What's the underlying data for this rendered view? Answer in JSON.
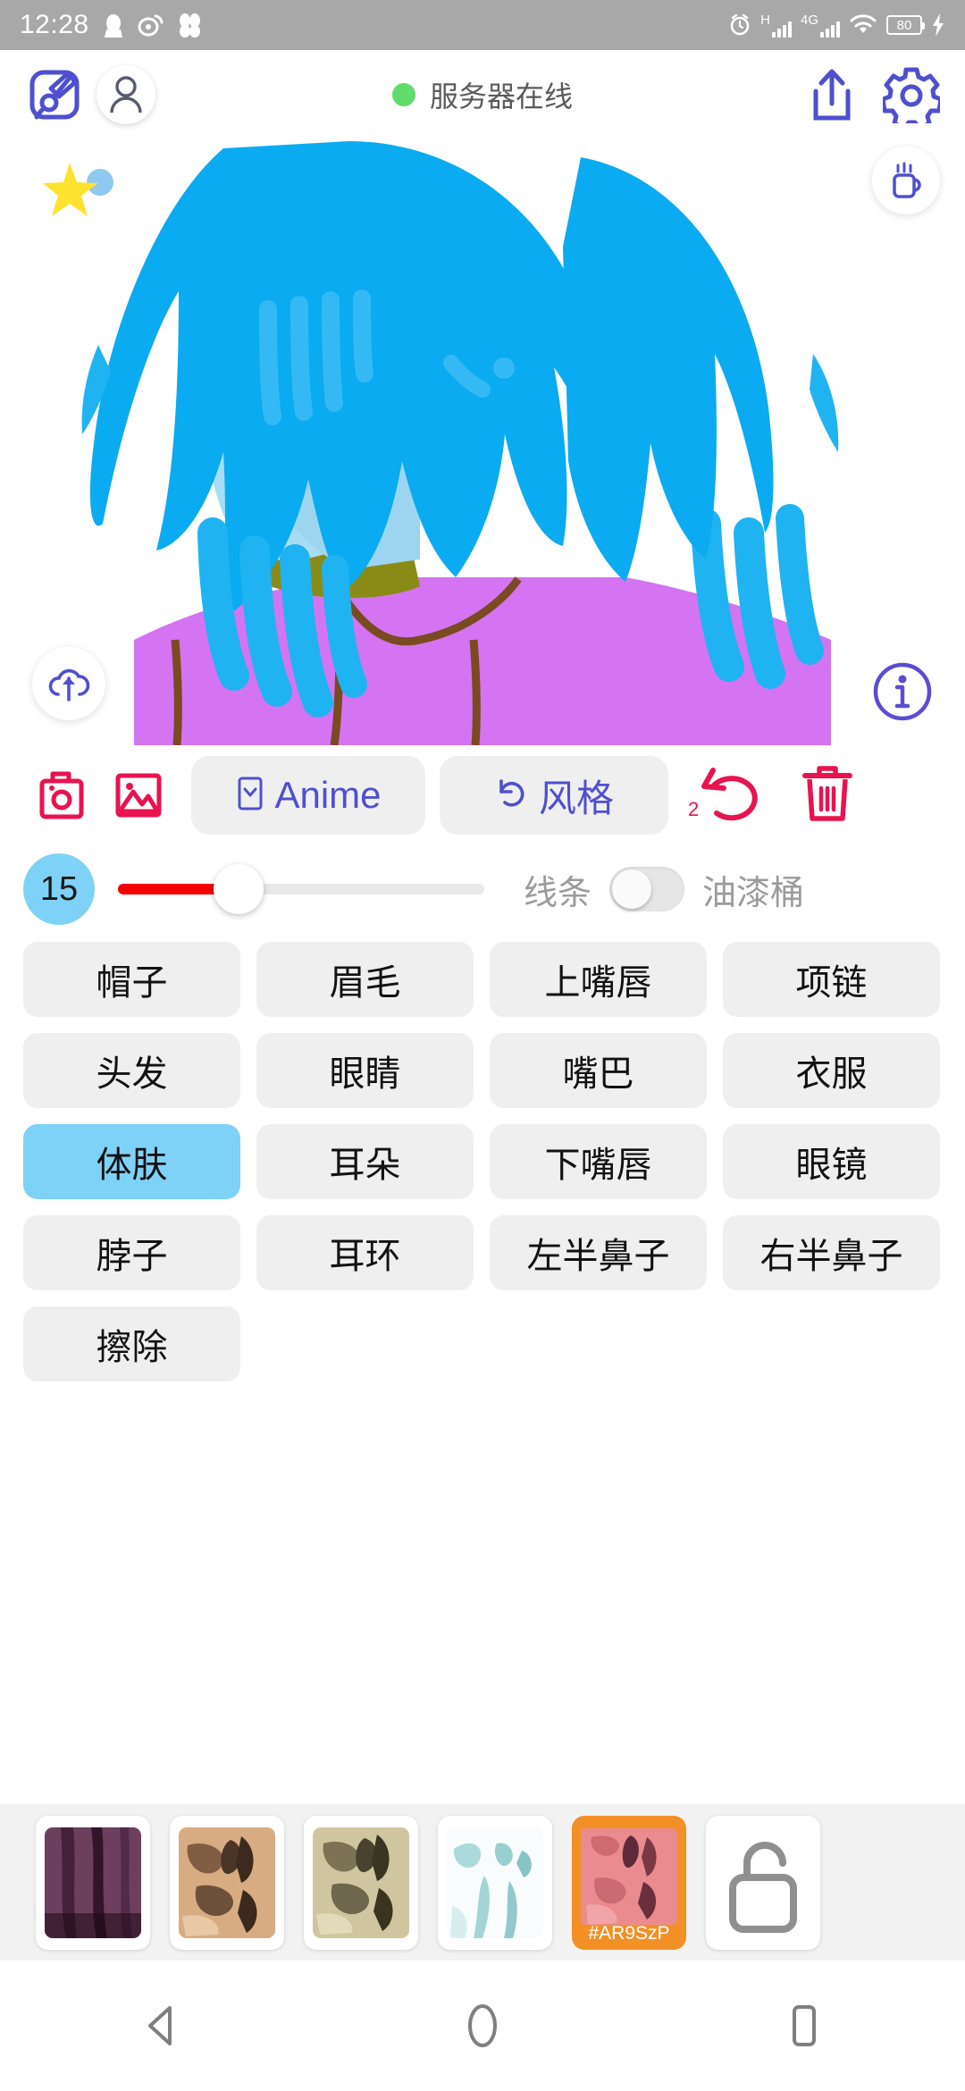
{
  "status_bar": {
    "time": "12:28",
    "left_icons": [
      "qq-penguin-icon",
      "weibo-icon",
      "app-icon"
    ],
    "right_icons": [
      "alarm-icon",
      "signal-h-icon",
      "signal-4g-icon",
      "wifi-icon",
      "battery-icon",
      "charging-bolt-icon"
    ],
    "network_h_label": "H",
    "network_4g_label": "4G",
    "battery_level": "80"
  },
  "app_bar": {
    "brush_icon": "brush-pen-icon",
    "avatar_icon": "user-avatar-icon",
    "server_status_text": "服务器在线",
    "server_status_color": "#5fdc6a",
    "share_icon": "share-upload-icon",
    "settings_icon": "gear-icon",
    "accent_color": "#4f4fd0"
  },
  "canvas": {
    "star_icon": "star-badge-icon",
    "coffee_icon": "coffee-mug-icon",
    "cloud_icon": "cloud-upload-icon",
    "info_icon": "info-circle-icon",
    "colors": {
      "hair": "#0aabf0",
      "skin": "#a6ddf5",
      "neck": "#8a8b16",
      "shirt": "#d574f2",
      "mouth_outer": "#e0125c",
      "mouth_inner": "#4a1030",
      "highlight": "#f7f3a0"
    }
  },
  "toolbar": {
    "camera_icon": "camera-icon",
    "gallery_icon": "image-gallery-icon",
    "anime_label": "Anime",
    "anime_icon": "chevron-down-box-icon",
    "style_label": "风格",
    "style_icon": "refresh-undo-icon",
    "undo_icon": "undo-arrow-icon",
    "undo_count": "2",
    "trash_icon": "trash-icon",
    "pink_color": "#e8134f",
    "purple_color": "#4f4fd0"
  },
  "slider_row": {
    "brush_size": "15",
    "fill_color": "#f40000",
    "chip_color": "#7fd2f7",
    "line_label": "线条",
    "bucket_label": "油漆桶",
    "toggle_on": false
  },
  "parts": [
    {
      "label": "帽子",
      "selected": false
    },
    {
      "label": "眉毛",
      "selected": false
    },
    {
      "label": "上嘴唇",
      "selected": false
    },
    {
      "label": "项链",
      "selected": false
    },
    {
      "label": "头发",
      "selected": false
    },
    {
      "label": "眼睛",
      "selected": false
    },
    {
      "label": "嘴巴",
      "selected": false
    },
    {
      "label": "衣服",
      "selected": false
    },
    {
      "label": "体肤",
      "selected": true
    },
    {
      "label": "耳朵",
      "selected": false
    },
    {
      "label": "下嘴唇",
      "selected": false
    },
    {
      "label": "眼镜",
      "selected": false
    },
    {
      "label": "脖子",
      "selected": false
    },
    {
      "label": "耳环",
      "selected": false
    },
    {
      "label": "左半鼻子",
      "selected": false
    },
    {
      "label": "右半鼻子",
      "selected": false
    },
    {
      "label": "擦除",
      "selected": false
    }
  ],
  "textures": [
    {
      "name": "texture-purple",
      "c1": "#6d3f5e",
      "c2": "#2c1022",
      "c3": "#8d5b7c",
      "selected": false,
      "tag": ""
    },
    {
      "name": "texture-tan",
      "c1": "#d8ac82",
      "c2": "#4b3526",
      "c3": "#f0d4b4",
      "selected": false,
      "tag": ""
    },
    {
      "name": "texture-beige",
      "c1": "#cfc69f",
      "c2": "#49422e",
      "c3": "#e9e2c4",
      "selected": false,
      "tag": ""
    },
    {
      "name": "texture-ice",
      "c1": "#f6fbfb",
      "c2": "#86c4c6",
      "c3": "#ffffff",
      "selected": false,
      "tag": ""
    },
    {
      "name": "texture-pink",
      "c1": "#e98b8f",
      "c2": "#5e2a3a",
      "c3": "#f4b0b2",
      "selected": true,
      "tag": "#AR9SzP"
    },
    {
      "name": "texture-lock",
      "c1": "#ffffff",
      "c2": "#9a9a9a",
      "c3": "#ffffff",
      "selected": false,
      "tag": ""
    }
  ],
  "nav_bar": {
    "back_icon": "nav-back-icon",
    "home_icon": "nav-home-icon",
    "recents_icon": "nav-recents-icon"
  }
}
